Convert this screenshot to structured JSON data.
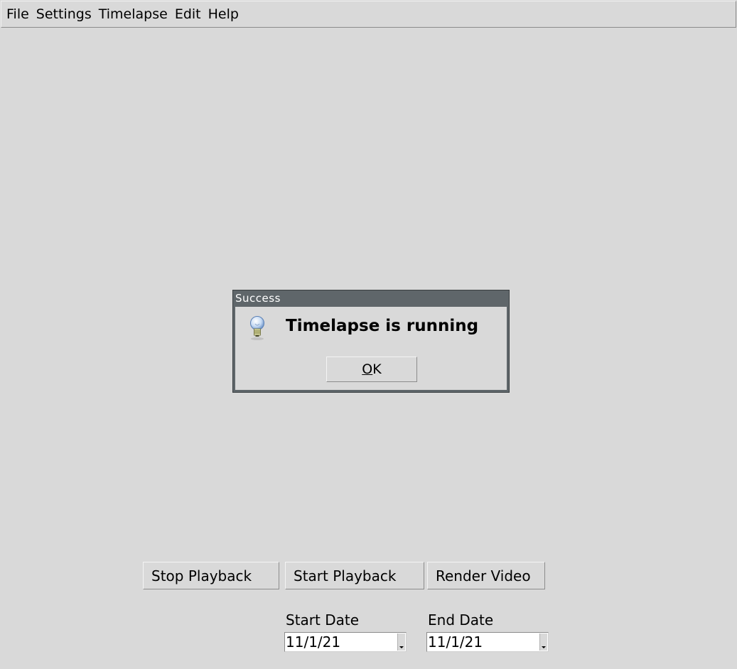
{
  "menubar": {
    "items": [
      "File",
      "Settings",
      "Timelapse",
      "Edit",
      "Help"
    ]
  },
  "dialog": {
    "title": "Success",
    "message": "Timelapse is running",
    "ok_mnemonic": "O",
    "ok_rest": "K",
    "icon": "lightbulb-icon"
  },
  "controls": {
    "stop_label": "Stop Playback",
    "start_label": "Start Playback",
    "render_label": "Render Video"
  },
  "dates": {
    "start_label": "Start Date",
    "start_value": "11/1/21",
    "end_label": "End Date",
    "end_value": "11/1/21"
  }
}
